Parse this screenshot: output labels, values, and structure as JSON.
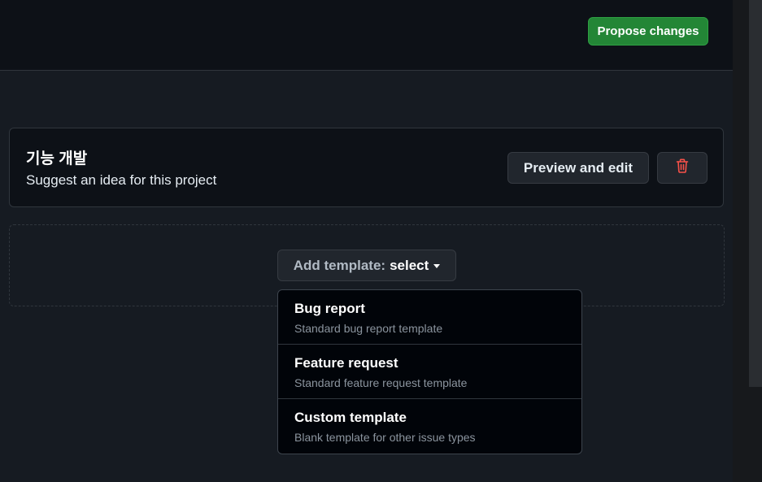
{
  "header": {
    "propose_label": "Propose changes"
  },
  "template_card": {
    "title": "기능 개발",
    "description": "Suggest an idea for this project",
    "preview_label": "Preview and edit",
    "delete_icon": "trash-icon"
  },
  "add_template": {
    "prefix": "Add template:",
    "value": "select",
    "caret_icon": "triangle-down-icon"
  },
  "dropdown": {
    "items": [
      {
        "name": "Bug report",
        "description": "Standard bug report template"
      },
      {
        "name": "Feature request",
        "description": "Standard feature request template"
      },
      {
        "name": "Custom template",
        "description": "Blank template for other issue types"
      }
    ]
  },
  "colors": {
    "accent_green": "#238636",
    "danger_red": "#f85149",
    "background": "#0d1117"
  }
}
